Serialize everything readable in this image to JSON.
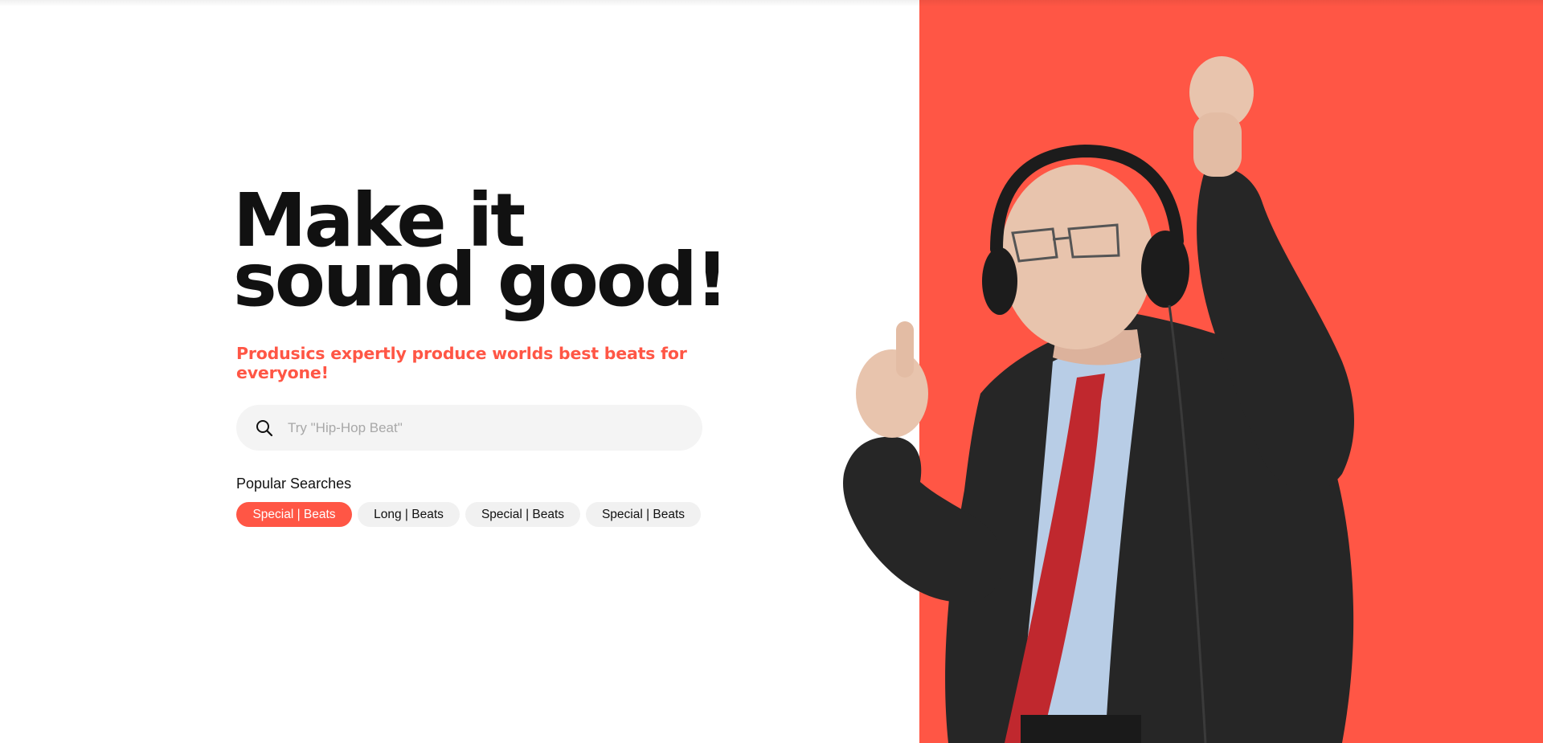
{
  "colors": {
    "accent": "#ff5645",
    "text_dark": "#111111",
    "search_bg": "#f4f4f4",
    "chip_bg": "#f1f1f1",
    "jacket": "#262626",
    "shirt": "#b8cde6",
    "tie": "#c0282e",
    "skin": "#e8c4ad"
  },
  "hero": {
    "headline_line1": "Make it",
    "headline_line2": "sound good!",
    "subtitle": "Produsics expertly produce worlds best beats for everyone!"
  },
  "search": {
    "icon": "search-icon",
    "placeholder": "Try \"Hip-Hop Beat\""
  },
  "popular": {
    "label": "Popular Searches",
    "chips": [
      {
        "label": "Special | Beats",
        "active": true
      },
      {
        "label": "Long | Beats",
        "active": false
      },
      {
        "label": "Special | Beats",
        "active": false
      },
      {
        "label": "Special | Beats",
        "active": false
      }
    ]
  },
  "image": {
    "subject": "elderly man in suit wearing headphones, dancing"
  }
}
